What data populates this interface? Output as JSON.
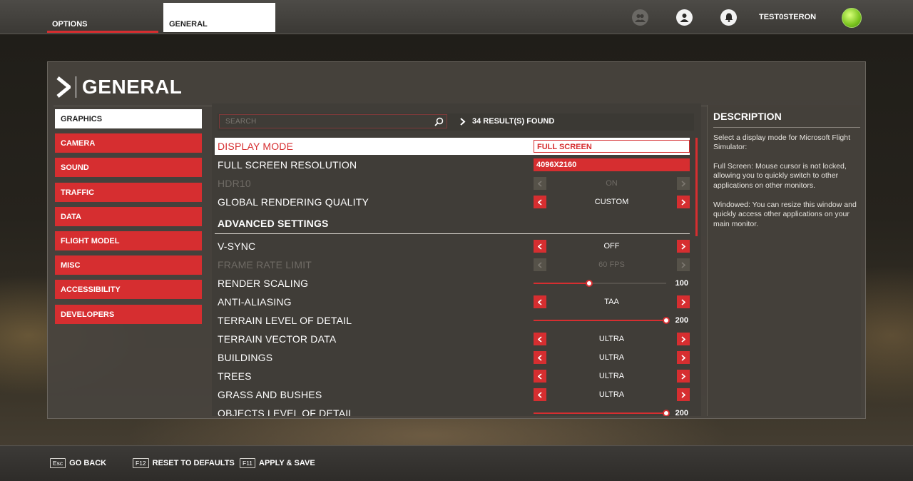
{
  "topbar": {
    "tab_options": "OPTIONS",
    "tab_general": "GENERAL",
    "username": "TEST0STERON",
    "icons": [
      "friends-icon",
      "profile-icon",
      "notifications-icon",
      "avatar"
    ]
  },
  "header": {
    "title": "GENERAL"
  },
  "sidebar": {
    "items": [
      {
        "label": "GRAPHICS",
        "active": true
      },
      {
        "label": "CAMERA"
      },
      {
        "label": "SOUND"
      },
      {
        "label": "TRAFFIC"
      },
      {
        "label": "DATA"
      },
      {
        "label": "FLIGHT MODEL"
      },
      {
        "label": "MISC"
      },
      {
        "label": "ACCESSIBILITY"
      },
      {
        "label": "DEVELOPERS"
      }
    ]
  },
  "search": {
    "placeholder": "SEARCH",
    "results": "34 RESULT(S) FOUND"
  },
  "settings": {
    "display_mode": {
      "label": "DISPLAY MODE",
      "value": "FULL SCREEN"
    },
    "full_screen_resolution": {
      "label": "FULL SCREEN RESOLUTION",
      "value": "4096X2160"
    },
    "hdr10": {
      "label": "HDR10",
      "value": "ON"
    },
    "global_rendering_quality": {
      "label": "GLOBAL RENDERING QUALITY",
      "value": "CUSTOM"
    },
    "advanced_settings": {
      "label": "ADVANCED SETTINGS"
    },
    "v_sync": {
      "label": "V-SYNC",
      "value": "OFF"
    },
    "frame_rate_limit": {
      "label": "FRAME RATE LIMIT",
      "value": "60 FPS"
    },
    "render_scaling": {
      "label": "RENDER SCALING",
      "value": "100",
      "level": 0.42
    },
    "anti_aliasing": {
      "label": "ANTI-ALIASING",
      "value": "TAA"
    },
    "terrain_lod": {
      "label": "TERRAIN LEVEL OF DETAIL",
      "value": "200",
      "level": 1.0
    },
    "terrain_vector_data": {
      "label": "TERRAIN VECTOR DATA",
      "value": "ULTRA"
    },
    "buildings": {
      "label": "BUILDINGS",
      "value": "ULTRA"
    },
    "trees": {
      "label": "TREES",
      "value": "ULTRA"
    },
    "grass_and_bushes": {
      "label": "GRASS AND BUSHES",
      "value": "ULTRA"
    },
    "objects_lod": {
      "label": "OBJECTS LEVEL OF DETAIL",
      "value": "200"
    }
  },
  "description": {
    "title": "DESCRIPTION",
    "p1": "Select a display mode for Microsoft Flight Simulator:",
    "p2": "Full Screen: Mouse cursor is not locked, allowing you to quickly switch to other applications on other monitors.",
    "p3": "Windowed: You can resize this window and quickly access other applications on your main monitor."
  },
  "bottom": {
    "back_key": "Esc",
    "back_label": "GO BACK",
    "reset_key": "F12",
    "reset_label": "RESET TO DEFAULTS",
    "apply_key": "F11",
    "apply_label": "APPLY & SAVE"
  },
  "colors": {
    "accent": "#d62e30",
    "panel": "#48443e"
  }
}
